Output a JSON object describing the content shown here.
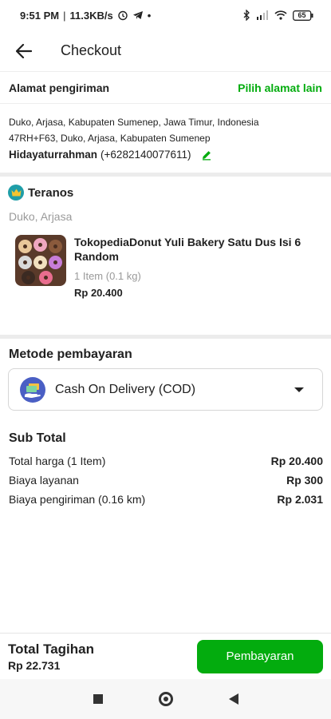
{
  "status_bar": {
    "time": "9:51 PM",
    "separator": "|",
    "speed": "11.3KB/s",
    "dot": "•",
    "battery": "65",
    "icons": [
      "alarm-icon",
      "telegram-icon",
      "bluetooth-icon",
      "signal-icon",
      "wifi-icon",
      "battery-icon"
    ]
  },
  "header": {
    "title": "Checkout"
  },
  "address": {
    "section_label": "Alamat pengiriman",
    "change_label": "Pilih alamat lain",
    "line1": "Duko, Arjasa, Kabupaten Sumenep, Jawa Timur, Indonesia",
    "line2": "47RH+F63, Duko, Arjasa, Kabupaten Sumenep",
    "recipient_name": "Hidayaturrahman",
    "recipient_phone": "(+6282140077611)"
  },
  "shop": {
    "name": "Teranos",
    "location": "Duko, Arjasa"
  },
  "product": {
    "name": "TokopediaDonut Yuli Bakery Satu Dus Isi 6 Random",
    "quantity": "1 Item (0.1 kg)",
    "price": "Rp 20.400"
  },
  "payment": {
    "section_label": "Metode pembayaran",
    "selected": "Cash On Delivery (COD)"
  },
  "subtotal": {
    "title": "Sub Total",
    "rows": [
      {
        "label": "Total harga (1 Item)",
        "value": "Rp 20.400"
      },
      {
        "label": "Biaya layanan",
        "value": "Rp 300"
      },
      {
        "label": "Biaya pengiriman (0.16 km)",
        "value": "Rp 2.031"
      }
    ]
  },
  "footer": {
    "total_label": "Total Tagihan",
    "total_value": "Rp 22.731",
    "pay_button": "Pembayaran"
  },
  "colors": {
    "accent": "#03ac0e",
    "shop_badge": "#1f9ea8",
    "muted_text": "#9a9a9a"
  }
}
